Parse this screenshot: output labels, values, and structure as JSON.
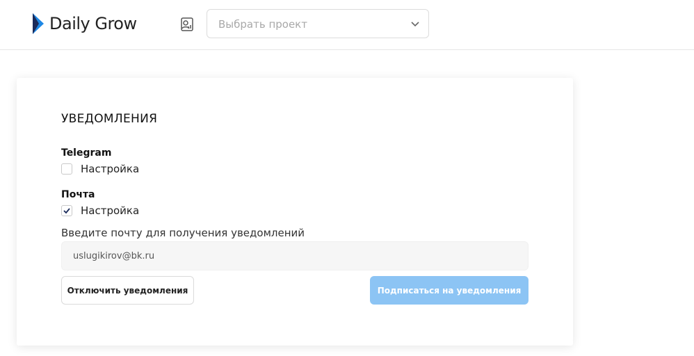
{
  "header": {
    "brand": "Daily Grow",
    "brand_colors": {
      "mark_dark": "#1a2a5a",
      "mark_blue": "#1e88e5"
    },
    "project_icon": "project-report-icon",
    "project_select": {
      "placeholder": "Выбрать проект",
      "chevron_icon": "chevron-down-icon"
    }
  },
  "notifications": {
    "title": "УВЕДОМЛЕНИЯ",
    "telegram": {
      "label": "Telegram",
      "option": "Настройка",
      "checked": false
    },
    "mail": {
      "label": "Почта",
      "option": "Настройка",
      "checked": true
    },
    "email_hint": "Введите почту для получения уведомлений",
    "email_value": "uslugikirov@bk.ru",
    "disable_button": "Отключить уведомления",
    "subscribe_button": "Подписаться на уведомления",
    "subscribe_color": "#8cc4f4"
  }
}
